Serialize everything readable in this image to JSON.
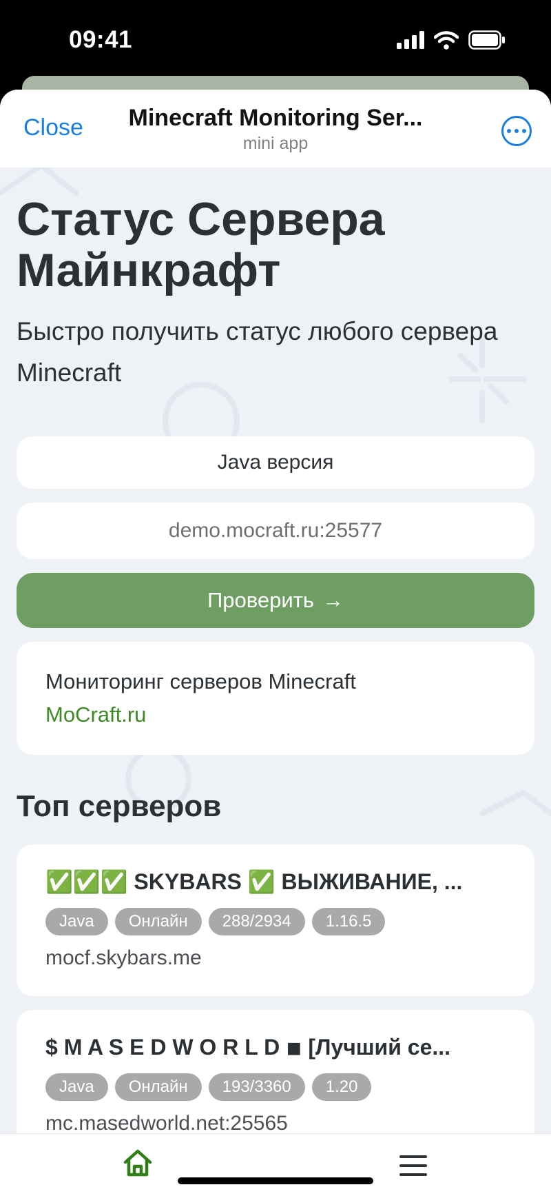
{
  "status_bar": {
    "time": "09:41"
  },
  "nav": {
    "close_label": "Close",
    "title": "Minecraft Monitoring Ser...",
    "subtitle": "mini app"
  },
  "hero": {
    "title": "Статус Сервера Майнкрафт",
    "subtitle": "Быстро получить статус любого сервера Minecraft"
  },
  "form": {
    "edition_selected": "Java версия",
    "address_placeholder": "demo.mocraft.ru:25577",
    "check_label": "Проверить",
    "check_arrow": "→"
  },
  "info": {
    "text": "Мониторинг серверов Minecraft",
    "link": "MoCraft.ru"
  },
  "top": {
    "title": "Топ серверов",
    "servers": [
      {
        "name": "✅✅✅ SKYBARS ✅ ВЫЖИВАНИЕ, ...",
        "edition": "Java",
        "status": "Онлайн",
        "players": "288/2934",
        "version": "1.16.5",
        "host": "mocf.skybars.me"
      },
      {
        "name": "$ M A S E D W O R L D ◾ [Лучший се...",
        "edition": "Java",
        "status": "Онлайн",
        "players": "193/3360",
        "version": "1.20",
        "host": "mc.masedworld.net:25565"
      }
    ]
  },
  "bottom_nav": {
    "home_icon": "home-icon",
    "menu_icon": "menu-icon"
  },
  "colors": {
    "accent_green": "#6f9e62",
    "link_green": "#3f8a24",
    "ios_blue": "#1a7ee0",
    "tag_gray": "#a7a9ab"
  }
}
